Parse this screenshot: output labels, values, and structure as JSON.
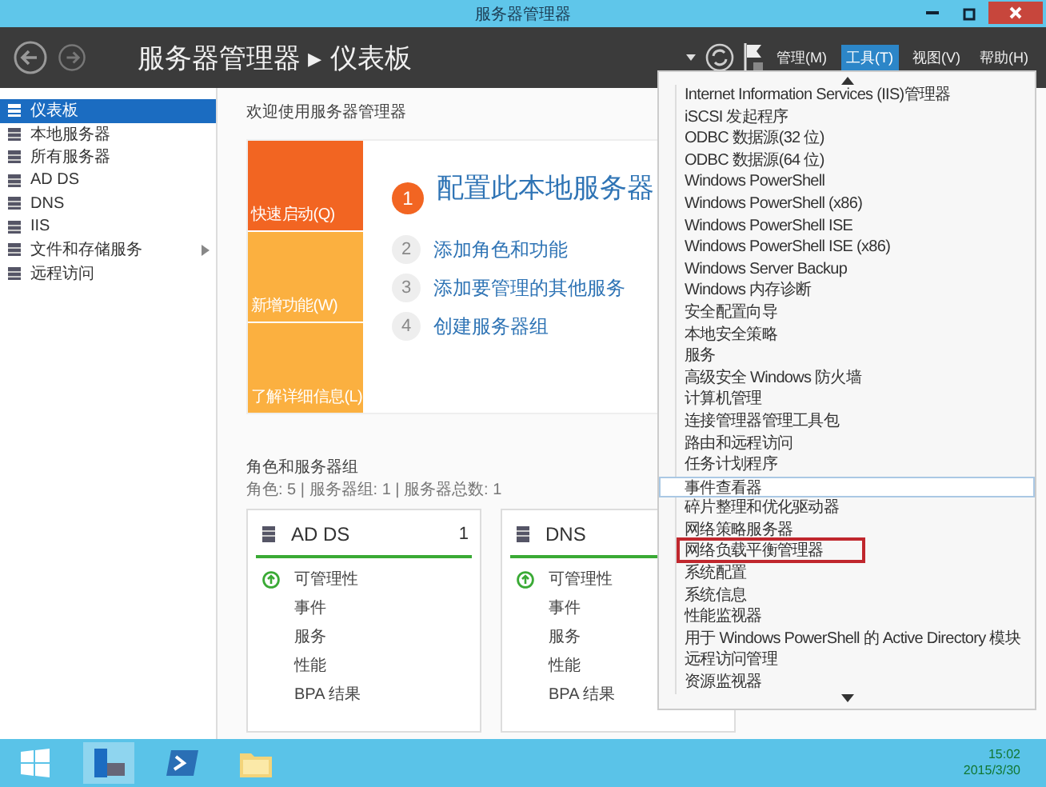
{
  "window": {
    "title": "服务器管理器"
  },
  "header": {
    "breadcrumb": "服务器管理器 ▸ 仪表板",
    "menus": [
      {
        "label": "管理(M)",
        "selected": false
      },
      {
        "label": "工具(T)",
        "selected": true
      },
      {
        "label": "视图(V)",
        "selected": false
      },
      {
        "label": "帮助(H)",
        "selected": false
      }
    ]
  },
  "sidebar": {
    "items": [
      {
        "label": "仪表板",
        "selected": true,
        "expandable": false
      },
      {
        "label": "本地服务器",
        "selected": false,
        "expandable": false
      },
      {
        "label": "所有服务器",
        "selected": false,
        "expandable": false
      },
      {
        "label": "AD DS",
        "selected": false,
        "expandable": false
      },
      {
        "label": "DNS",
        "selected": false,
        "expandable": false
      },
      {
        "label": "IIS",
        "selected": false,
        "expandable": false
      },
      {
        "label": "文件和存储服务",
        "selected": false,
        "expandable": true
      },
      {
        "label": "远程访问",
        "selected": false,
        "expandable": false
      }
    ]
  },
  "welcome": {
    "title": "欢迎使用服务器管理器",
    "tiles": [
      {
        "label": "快速启动(Q)",
        "color": "#f26522"
      },
      {
        "label": "新增功能(W)",
        "color": "#fbb040"
      },
      {
        "label": "了解详细信息(L)",
        "color": "#fbb040"
      }
    ],
    "steps": [
      {
        "number": "1",
        "label": "配置此本地服务器",
        "kind": "primary"
      },
      {
        "number": "2",
        "label": "添加角色和功能",
        "kind": "secondary"
      },
      {
        "number": "3",
        "label": "添加要管理的其他服务",
        "kind": "secondary"
      },
      {
        "number": "4",
        "label": "创建服务器组",
        "kind": "secondary"
      }
    ]
  },
  "roles": {
    "title": "角色和服务器组",
    "summary": "角色: 5 | 服务器组: 1 | 服务器总数: 1",
    "cards": [
      {
        "name": "AD DS",
        "count": "1",
        "rows": [
          {
            "label": "可管理性",
            "kind": "status"
          },
          {
            "label": "事件",
            "kind": "plain"
          },
          {
            "label": "服务",
            "kind": "plain"
          },
          {
            "label": "性能",
            "kind": "plain"
          },
          {
            "label": "BPA 结果",
            "kind": "plain"
          }
        ]
      },
      {
        "name": "DNS",
        "rows": [
          {
            "label": "可管理性",
            "kind": "status"
          },
          {
            "label": "事件",
            "kind": "plain"
          },
          {
            "label": "服务",
            "kind": "plain"
          },
          {
            "label": "性能",
            "kind": "plain"
          },
          {
            "label": "BPA 结果",
            "kind": "plain"
          }
        ]
      }
    ]
  },
  "tools_menu": {
    "items": [
      {
        "label": "Internet Information Services (IIS)管理器",
        "hovered": false,
        "marked": false
      },
      {
        "label": "iSCSI 发起程序",
        "hovered": false,
        "marked": false
      },
      {
        "label": "ODBC 数据源(32 位)",
        "hovered": false,
        "marked": false
      },
      {
        "label": "ODBC 数据源(64 位)",
        "hovered": false,
        "marked": false
      },
      {
        "label": "Windows PowerShell",
        "hovered": false,
        "marked": false
      },
      {
        "label": "Windows PowerShell (x86)",
        "hovered": false,
        "marked": false
      },
      {
        "label": "Windows PowerShell ISE",
        "hovered": false,
        "marked": false
      },
      {
        "label": "Windows PowerShell ISE (x86)",
        "hovered": false,
        "marked": false
      },
      {
        "label": "Windows Server Backup",
        "hovered": false,
        "marked": false
      },
      {
        "label": "Windows 内存诊断",
        "hovered": false,
        "marked": false
      },
      {
        "label": "安全配置向导",
        "hovered": false,
        "marked": false
      },
      {
        "label": "本地安全策略",
        "hovered": false,
        "marked": false
      },
      {
        "label": "服务",
        "hovered": false,
        "marked": false
      },
      {
        "label": "高级安全 Windows 防火墙",
        "hovered": false,
        "marked": false
      },
      {
        "label": "计算机管理",
        "hovered": false,
        "marked": false
      },
      {
        "label": "连接管理器管理工具包",
        "hovered": false,
        "marked": false
      },
      {
        "label": "路由和远程访问",
        "hovered": false,
        "marked": false
      },
      {
        "label": "任务计划程序",
        "hovered": false,
        "marked": false
      },
      {
        "label": "事件查看器",
        "hovered": true,
        "marked": false
      },
      {
        "label": "碎片整理和优化驱动器",
        "hovered": false,
        "marked": false
      },
      {
        "label": "网络策略服务器",
        "hovered": false,
        "marked": false
      },
      {
        "label": "网络负载平衡管理器",
        "hovered": false,
        "marked": true
      },
      {
        "label": "系统配置",
        "hovered": false,
        "marked": false
      },
      {
        "label": "系统信息",
        "hovered": false,
        "marked": false
      },
      {
        "label": "性能监视器",
        "hovered": false,
        "marked": false
      },
      {
        "label": "用于 Windows PowerShell 的 Active Directory 模块",
        "hovered": false,
        "marked": false
      },
      {
        "label": "远程访问管理",
        "hovered": false,
        "marked": false
      },
      {
        "label": "资源监视器",
        "hovered": false,
        "marked": false
      }
    ]
  },
  "taskbar": {
    "time": "15:02",
    "date": "2015/3/30"
  }
}
